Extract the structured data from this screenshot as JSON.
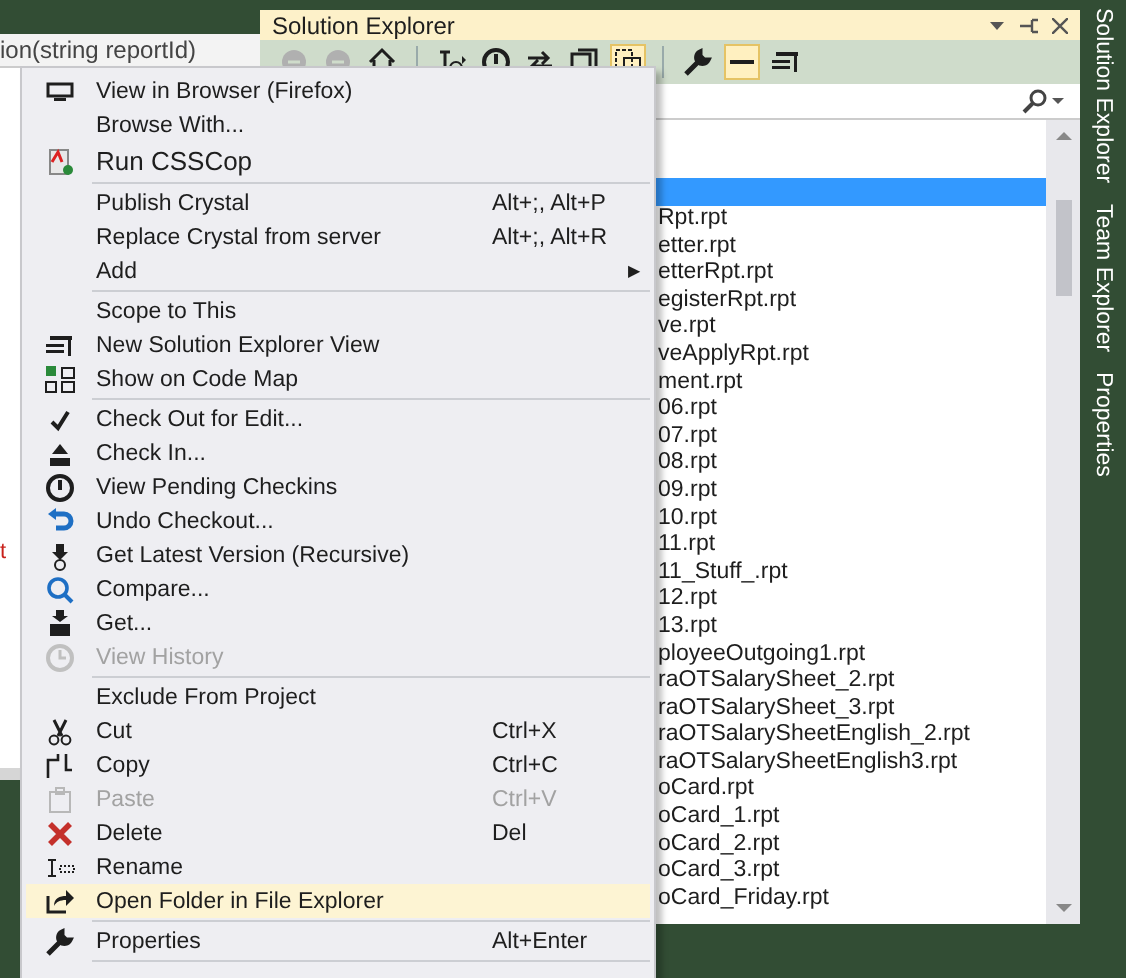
{
  "editor": {
    "tab_text": "ion(string reportId)",
    "code_fragment": "t"
  },
  "solution_explorer": {
    "title": "Solution Explorer",
    "toolbar": [
      {
        "on": false,
        "disabled": true
      },
      {
        "on": false,
        "disabled": true
      },
      {
        "on": false,
        "disabled": false
      },
      {
        "on": false,
        "disabled": false
      },
      {
        "on": false,
        "disabled": false
      },
      {
        "on": false,
        "disabled": false
      },
      {
        "on": false,
        "disabled": false
      },
      {
        "on": true,
        "disabled": false
      },
      {
        "on": false,
        "disabled": false
      },
      {
        "on": true,
        "disabled": false
      },
      {
        "on": false,
        "disabled": false
      }
    ],
    "tree": [
      {
        "selected": true
      },
      {
        "name": "Rpt.rpt",
        "selected": false
      },
      {
        "name": "etter.rpt",
        "selected": false
      },
      {
        "name": "etterRpt.rpt",
        "selected": false
      },
      {
        "name": "egisterRpt.rpt",
        "selected": false
      },
      {
        "name": "ve.rpt",
        "selected": false
      },
      {
        "name": "veApplyRpt.rpt",
        "selected": false
      },
      {
        "name": "ment.rpt",
        "selected": false
      },
      {
        "name": "06.rpt",
        "selected": false
      },
      {
        "name": "07.rpt",
        "selected": false
      },
      {
        "name": "08.rpt",
        "selected": false
      },
      {
        "name": "09.rpt",
        "selected": false
      },
      {
        "name": "10.rpt",
        "selected": false
      },
      {
        "name": "11.rpt",
        "selected": false
      },
      {
        "name": "11_Stuff_.rpt",
        "selected": false
      },
      {
        "name": "12.rpt",
        "selected": false
      },
      {
        "name": "13.rpt",
        "selected": false
      },
      {
        "name": "ployeeOutgoing1.rpt",
        "selected": false
      },
      {
        "name": "raOTSalarySheet_2.rpt",
        "selected": false
      },
      {
        "name": "raOTSalarySheet_3.rpt",
        "selected": false
      },
      {
        "name": "raOTSalarySheetEnglish_2.rpt",
        "selected": false
      },
      {
        "name": "raOTSalarySheetEnglish3.rpt",
        "selected": false
      },
      {
        "name": "oCard.rpt",
        "selected": false
      },
      {
        "name": "oCard_1.rpt",
        "selected": false
      },
      {
        "name": "oCard_2.rpt",
        "selected": false
      },
      {
        "name": "oCard_3.rpt",
        "selected": false
      },
      {
        "name": "oCard_Friday.rpt",
        "selected": false
      }
    ]
  },
  "context_menu": {
    "items": [
      {
        "kind": "item",
        "label": "View in Browser (Firefox)",
        "disabled": false,
        "highlighted": false
      },
      {
        "kind": "item",
        "label": "Browse With...",
        "disabled": false,
        "highlighted": false
      },
      {
        "kind": "item",
        "label": "Run CSSCop",
        "disabled": false,
        "highlighted": false
      },
      {
        "kind": "separator"
      },
      {
        "kind": "item",
        "label": "Publish Crystal",
        "shortcut": "Alt+;, Alt+P",
        "disabled": false,
        "highlighted": false
      },
      {
        "kind": "item",
        "label": "Replace Crystal from server",
        "shortcut": "Alt+;, Alt+R",
        "disabled": false,
        "highlighted": false
      },
      {
        "kind": "submenu",
        "label": "Add",
        "arrow": "▶",
        "disabled": false,
        "highlighted": false
      },
      {
        "kind": "separator"
      },
      {
        "kind": "item",
        "label": "Scope to This",
        "disabled": false,
        "highlighted": false
      },
      {
        "kind": "item",
        "label": "New Solution Explorer View",
        "disabled": false,
        "highlighted": false
      },
      {
        "kind": "item",
        "label": "Show on Code Map",
        "disabled": false,
        "highlighted": false
      },
      {
        "kind": "separator"
      },
      {
        "kind": "item",
        "label": "Check Out for Edit...",
        "disabled": false,
        "highlighted": false
      },
      {
        "kind": "item",
        "label": "Check In...",
        "disabled": false,
        "highlighted": false
      },
      {
        "kind": "item",
        "label": "View Pending Checkins",
        "disabled": false,
        "highlighted": false
      },
      {
        "kind": "item",
        "label": "Undo Checkout...",
        "disabled": false,
        "highlighted": false
      },
      {
        "kind": "item",
        "label": "Get Latest Version (Recursive)",
        "disabled": false,
        "highlighted": false
      },
      {
        "kind": "item",
        "label": "Compare...",
        "disabled": false,
        "highlighted": false
      },
      {
        "kind": "item",
        "label": "Get...",
        "disabled": false,
        "highlighted": false
      },
      {
        "kind": "item",
        "label": "View History",
        "disabled": true,
        "highlighted": false
      },
      {
        "kind": "separator"
      },
      {
        "kind": "item",
        "label": "Exclude From Project",
        "disabled": false,
        "highlighted": false
      },
      {
        "kind": "item",
        "label": "Cut",
        "shortcut": "Ctrl+X",
        "disabled": false,
        "highlighted": false
      },
      {
        "kind": "item",
        "label": "Copy",
        "shortcut": "Ctrl+C",
        "disabled": false,
        "highlighted": false
      },
      {
        "kind": "item",
        "label": "Paste",
        "shortcut": "Ctrl+V",
        "disabled": true,
        "highlighted": false
      },
      {
        "kind": "item",
        "label": "Delete",
        "shortcut": "Del",
        "disabled": false,
        "highlighted": false
      },
      {
        "kind": "item",
        "label": "Rename",
        "disabled": false,
        "highlighted": false
      },
      {
        "kind": "item",
        "label": "Open Folder in File Explorer",
        "disabled": false,
        "highlighted": true
      },
      {
        "kind": "separator"
      },
      {
        "kind": "item",
        "label": "Properties",
        "shortcut": "Alt+Enter",
        "disabled": false,
        "highlighted": false
      },
      {
        "kind": "separator"
      }
    ]
  },
  "side_tabs": [
    {
      "label": "Solution Explorer"
    },
    {
      "label": "Team Explorer"
    },
    {
      "label": "Properties"
    }
  ]
}
